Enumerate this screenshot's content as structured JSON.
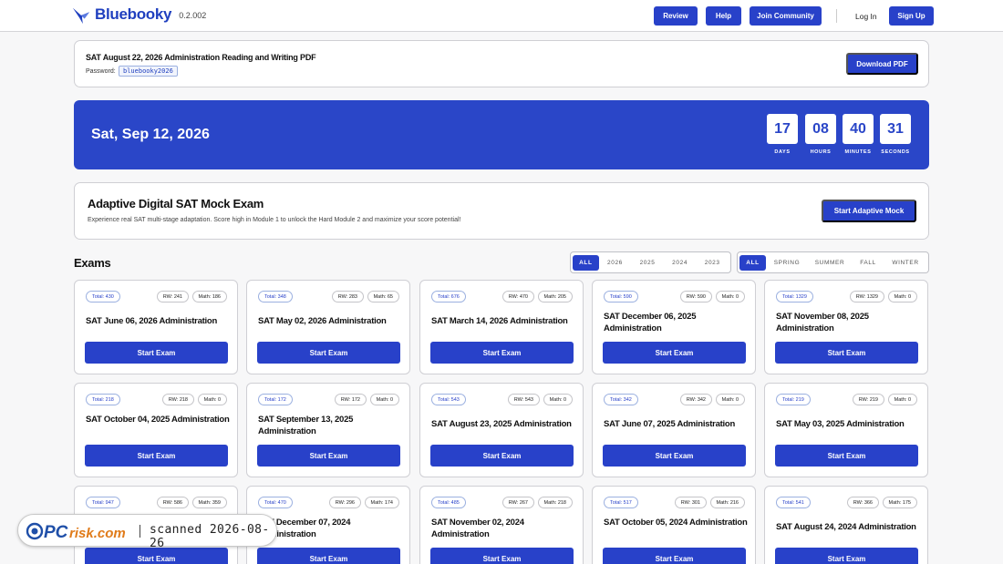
{
  "header": {
    "brand": "Bluebooky",
    "version": "0.2.002",
    "nav": [
      {
        "label": "Review"
      },
      {
        "label": "Help"
      },
      {
        "label": "Join Community"
      }
    ],
    "login": "Log In",
    "signup": "Sign Up"
  },
  "pdf": {
    "title": "SAT August 22, 2026 Administration Reading and Writing PDF",
    "password_label": "Password:",
    "password": "bluebooky2026",
    "download": "Download PDF"
  },
  "countdown": {
    "date": "Sat, Sep 12, 2026",
    "units": [
      {
        "value": "17",
        "label": "DAYS"
      },
      {
        "value": "08",
        "label": "HOURS"
      },
      {
        "value": "40",
        "label": "MINUTES"
      },
      {
        "value": "31",
        "label": "SECONDS"
      }
    ]
  },
  "adaptive": {
    "title": "Adaptive Digital SAT Mock Exam",
    "description": "Experience real SAT multi-stage adaptation. Score high in Module 1 to unlock the Hard Module 2 and maximize your score potential!",
    "button": "Start Adaptive Mock"
  },
  "exams": {
    "title": "Exams",
    "year_filters": [
      "ALL",
      "2026",
      "2025",
      "2024",
      "2023"
    ],
    "season_filters": [
      "ALL",
      "SPRING",
      "SUMMER",
      "FALL",
      "WINTER"
    ],
    "button_label": "Start Exam",
    "cards": [
      {
        "total": "Total: 430",
        "rw": "RW: 241",
        "math": "Math: 186",
        "title": "SAT June 06, 2026 Administration"
      },
      {
        "total": "Total: 348",
        "rw": "RW: 283",
        "math": "Math: 65",
        "title": "SAT May 02, 2026 Administration"
      },
      {
        "total": "Total: 676",
        "rw": "RW: 470",
        "math": "Math: 205",
        "title": "SAT March 14, 2026 Administration"
      },
      {
        "total": "Total: 590",
        "rw": "RW: 590",
        "math": "Math: 0",
        "title": "SAT December 06, 2025 Administration"
      },
      {
        "total": "Total: 1329",
        "rw": "RW: 1329",
        "math": "Math: 0",
        "title": "SAT November 08, 2025 Administration"
      },
      {
        "total": "Total: 218",
        "rw": "RW: 218",
        "math": "Math: 0",
        "title": "SAT October 04, 2025 Administration"
      },
      {
        "total": "Total: 172",
        "rw": "RW: 172",
        "math": "Math: 0",
        "title": "SAT September 13, 2025 Administration"
      },
      {
        "total": "Total: 543",
        "rw": "RW: 543",
        "math": "Math: 0",
        "title": "SAT August 23, 2025 Administration"
      },
      {
        "total": "Total: 342",
        "rw": "RW: 342",
        "math": "Math: 0",
        "title": "SAT June 07, 2025 Administration"
      },
      {
        "total": "Total: 219",
        "rw": "RW: 219",
        "math": "Math: 0",
        "title": "SAT May 03, 2025 Administration"
      },
      {
        "total": "Total: 947",
        "rw": "RW: 586",
        "math": "Math: 359",
        "title": ""
      },
      {
        "total": "Total: 470",
        "rw": "RW: 296",
        "math": "Math: 174",
        "title": "SAT December 07, 2024 Administration"
      },
      {
        "total": "Total: 485",
        "rw": "RW: 267",
        "math": "Math: 218",
        "title": "SAT November 02, 2024 Administration"
      },
      {
        "total": "Total: 517",
        "rw": "RW: 301",
        "math": "Math: 216",
        "title": "SAT October 05, 2024 Administration"
      },
      {
        "total": "Total: 541",
        "rw": "RW: 366",
        "math": "Math: 175",
        "title": "SAT August 24, 2024 Administration"
      }
    ]
  },
  "watermark": {
    "brand": "PCrisk.com",
    "text": "scanned 2026-08-26"
  },
  "colors": {
    "accent": "#2841c9",
    "banner": "#2a46c8",
    "background": "#f7f7f8"
  }
}
